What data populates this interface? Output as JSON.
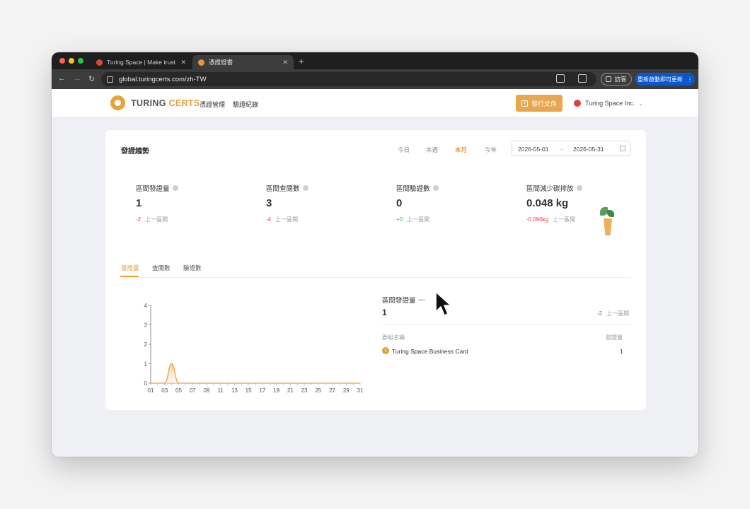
{
  "browser": {
    "tabs": [
      {
        "title": "Turing Space | Make trust ac",
        "close": "✕"
      },
      {
        "title": "憑證證書",
        "close": "✕"
      }
    ],
    "new_tab": "+",
    "nav": {
      "back": "←",
      "forward": "→",
      "reload": "↻"
    },
    "url": "global.turingcerts.com/zh-TW",
    "guest_label": "訪客",
    "update_label": "重新啟動即可更新",
    "update_menu": "⋮"
  },
  "site": {
    "logo_word1": "TURING",
    "logo_word2": "CERTS",
    "nav": [
      "憑證管理",
      "驗證紀錄"
    ],
    "issue_button": "發行文件",
    "issue_plus": "+",
    "org_name": "Turing Space Inc.",
    "org_chevron": "⌄"
  },
  "dashboard": {
    "title": "發證趨勢",
    "periods": [
      "今日",
      "本週",
      "本月",
      "今年"
    ],
    "active_period": "本月",
    "date_start": "2026-05-01",
    "date_arrow": "→",
    "date_end": "2026-05-31",
    "stats": [
      {
        "label": "區間發證量",
        "value": "1",
        "delta": "-2",
        "delta_label": "上一區間"
      },
      {
        "label": "區間查閱數",
        "value": "3",
        "delta": "-4",
        "delta_label": "上一區間"
      },
      {
        "label": "區間驗證數",
        "value": "0",
        "delta": "+0",
        "delta_label": "上一區間"
      },
      {
        "label": "區間減少碳排放",
        "value": "0.048 kg",
        "delta": "-0.096kg",
        "delta_label": "上一區間"
      }
    ],
    "subtabs": [
      "發證量",
      "查閱數",
      "驗證數"
    ],
    "active_subtab": "發證量",
    "summary": {
      "title": "區間發證量",
      "trend_icon": "〰",
      "value": "1",
      "delta": "-2",
      "delta_label": "上一區間",
      "col_name": "群組名稱",
      "col_count": "發證量",
      "rows": [
        {
          "badge": "!",
          "name": "Turing Space Business Card",
          "count": "1"
        }
      ]
    }
  },
  "colors": {
    "accent": "#e39f3c",
    "negative": "#e0454a",
    "positive": "#4caf50",
    "update_blue": "#0b57d0"
  },
  "chart_data": {
    "type": "area",
    "x": [
      "01",
      "02",
      "03",
      "04",
      "05",
      "06",
      "07",
      "08",
      "09",
      "10",
      "11",
      "12",
      "13",
      "14",
      "15",
      "16",
      "17",
      "18",
      "19",
      "20",
      "21",
      "22",
      "23",
      "24",
      "25",
      "26",
      "27",
      "28",
      "29",
      "30",
      "31"
    ],
    "x_tick_labels": [
      "01",
      "03",
      "05",
      "07",
      "09",
      "11",
      "13",
      "15",
      "17",
      "19",
      "21",
      "23",
      "25",
      "27",
      "29",
      "31"
    ],
    "series": [
      {
        "values": [
          0,
          0,
          0,
          1,
          0,
          0,
          0,
          0,
          0,
          0,
          0,
          0,
          0,
          0,
          0,
          0,
          0,
          0,
          0,
          0,
          0,
          0,
          0,
          0,
          0,
          0,
          0,
          0,
          0,
          0,
          0
        ]
      }
    ],
    "ylim": [
      0,
      4
    ],
    "y_ticks": [
      0,
      1,
      2,
      3,
      4
    ],
    "title": "",
    "xlabel": "",
    "ylabel": "",
    "grid": false
  }
}
